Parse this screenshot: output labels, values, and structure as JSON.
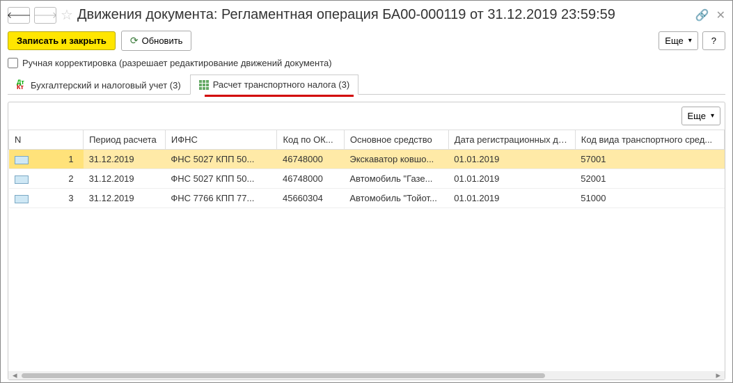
{
  "title": "Движения документа: Регламентная операция БА00-000119 от 31.12.2019 23:59:59",
  "toolbar": {
    "save_close": "Записать и закрыть",
    "refresh": "Обновить",
    "more": "Еще",
    "help": "?"
  },
  "checkbox_label": "Ручная корректировка (разрешает редактирование движений документа)",
  "tabs": [
    {
      "label": "Бухгалтерский и налоговый учет (3)"
    },
    {
      "label": "Расчет транспортного налога (3)"
    }
  ],
  "panel": {
    "more": "Еще"
  },
  "columns": {
    "n": "N",
    "period": "Период расчета",
    "ifns": "ИФНС",
    "kod": "Код по ОК...",
    "os": "Основное средство",
    "date": "Дата регистрационных данных",
    "kvid": "Код вида транспортного сред..."
  },
  "rows": [
    {
      "n": "1",
      "period": "31.12.2019",
      "ifns": "ФНС 5027 КПП 50...",
      "kod": "46748000",
      "os": "Экскаватор ковшо...",
      "date": "01.01.2019",
      "kvid": "57001"
    },
    {
      "n": "2",
      "period": "31.12.2019",
      "ifns": "ФНС 5027 КПП 50...",
      "kod": "46748000",
      "os": "Автомобиль \"Газе...",
      "date": "01.01.2019",
      "kvid": "52001"
    },
    {
      "n": "3",
      "period": "31.12.2019",
      "ifns": "ФНС 7766 КПП 77...",
      "kod": "45660304",
      "os": "Автомобиль \"Тойот...",
      "date": "01.01.2019",
      "kvid": "51000"
    }
  ]
}
